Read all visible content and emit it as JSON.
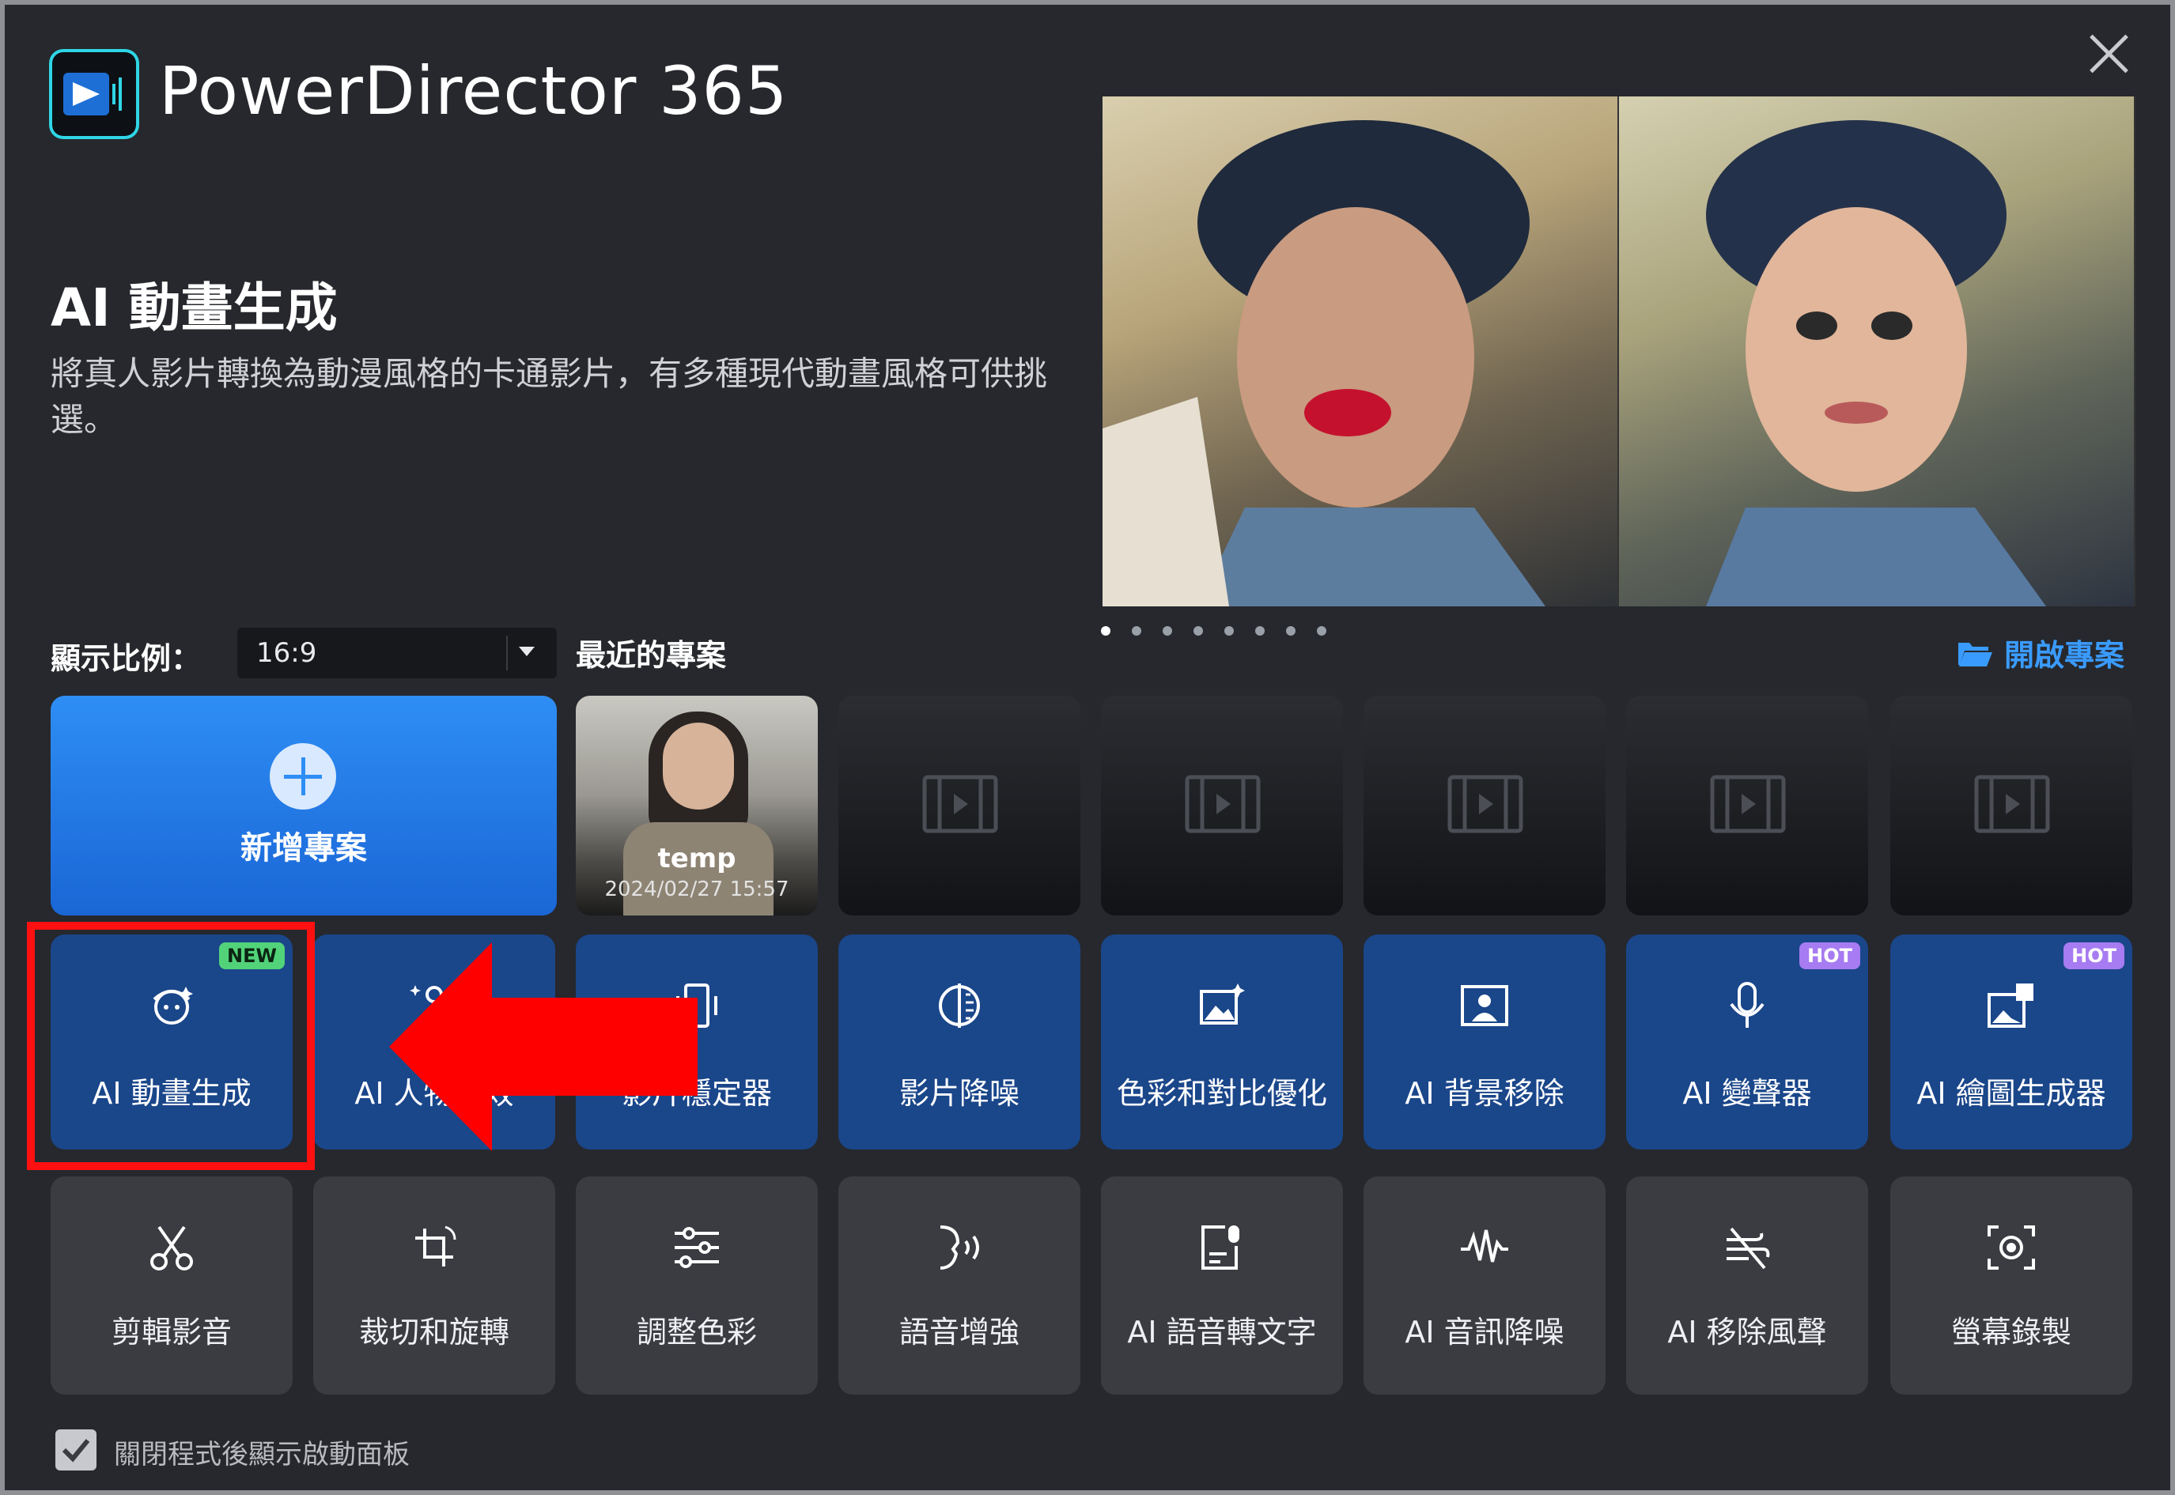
{
  "app": {
    "title": "PowerDirector 365"
  },
  "feature": {
    "title": "AI 動畫生成",
    "description": "將真人影片轉換為動漫風格的卡通影片，有多種現代動畫風格可供挑選。"
  },
  "carousel": {
    "slides": 8,
    "active": 1
  },
  "aspect": {
    "label": "顯示比例：",
    "value": "16:9"
  },
  "recent": {
    "label": "最近的專案",
    "open_label": "開啟專案",
    "new_project_label": "新增專案",
    "items": [
      {
        "name": "temp",
        "date": "2024/02/27 15:57"
      }
    ]
  },
  "features_row1": [
    {
      "label": "AI 動畫生成",
      "badge": "NEW",
      "icon": "ai-anime-icon"
    },
    {
      "label": "AI 人物特效",
      "badge": "",
      "icon": "ai-body-effect-icon"
    },
    {
      "label": "影片穩定器",
      "badge": "",
      "icon": "stabilizer-icon"
    },
    {
      "label": "影片降噪",
      "badge": "",
      "icon": "denoise-icon"
    },
    {
      "label": "色彩和對比優化",
      "badge": "",
      "icon": "color-enhance-icon"
    },
    {
      "label": "AI 背景移除",
      "badge": "",
      "icon": "background-removal-icon"
    },
    {
      "label": "AI 變聲器",
      "badge": "HOT",
      "icon": "microphone-icon"
    },
    {
      "label": "AI 繪圖生成器",
      "badge": "HOT",
      "icon": "image-generator-icon"
    }
  ],
  "features_row2": [
    {
      "label": "剪輯影音",
      "icon": "scissors-icon"
    },
    {
      "label": "裁切和旋轉",
      "icon": "crop-rotate-icon"
    },
    {
      "label": "調整色彩",
      "icon": "sliders-icon"
    },
    {
      "label": "語音增強",
      "icon": "voice-enhance-icon"
    },
    {
      "label": "AI 語音轉文字",
      "icon": "speech-to-text-icon"
    },
    {
      "label": "AI 音訊降噪",
      "icon": "audio-denoise-icon"
    },
    {
      "label": "AI 移除風聲",
      "icon": "wind-removal-icon"
    },
    {
      "label": "螢幕錄製",
      "icon": "screen-record-icon"
    }
  ],
  "footer": {
    "checkbox_label": "關閉程式後顯示啟動面板",
    "checked": true
  },
  "colors": {
    "accent_blue": "#2e8ef5",
    "feature_tile": "#1a468a",
    "tool_tile": "#3a3c42",
    "highlight_red": "#ff1010"
  }
}
